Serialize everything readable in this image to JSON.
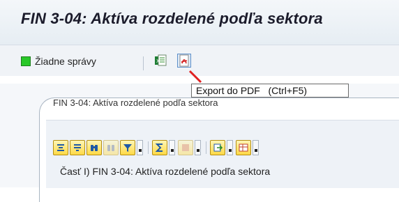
{
  "window": {
    "title": "FIN 3-04: Aktíva rozdelené podľa sektora"
  },
  "toolbar": {
    "status_text": "Žiadne správy",
    "status_color": "#29c829",
    "buttons": [
      {
        "icon": "excel-export-icon"
      },
      {
        "icon": "pdf-export-icon"
      }
    ],
    "tooltip": "Export do PDF   (Ctrl+F5)"
  },
  "tab": {
    "label": "FIN 3-04: Aktíva rozdelené podľa sektora"
  },
  "alv": {
    "toolbar_icons": [
      "align-icon",
      "filter-rows-icon",
      "find-icon",
      "find-next-icon",
      "filter-icon",
      "sum-icon",
      "subtotal-icon",
      "export-icon",
      "layout-icon"
    ],
    "section_title": "Časť I) FIN 3-04: Aktíva rozdelené podľa sektora"
  },
  "colors": {
    "accent": "#5b8ec8",
    "button_yellow": "#ffd946"
  }
}
